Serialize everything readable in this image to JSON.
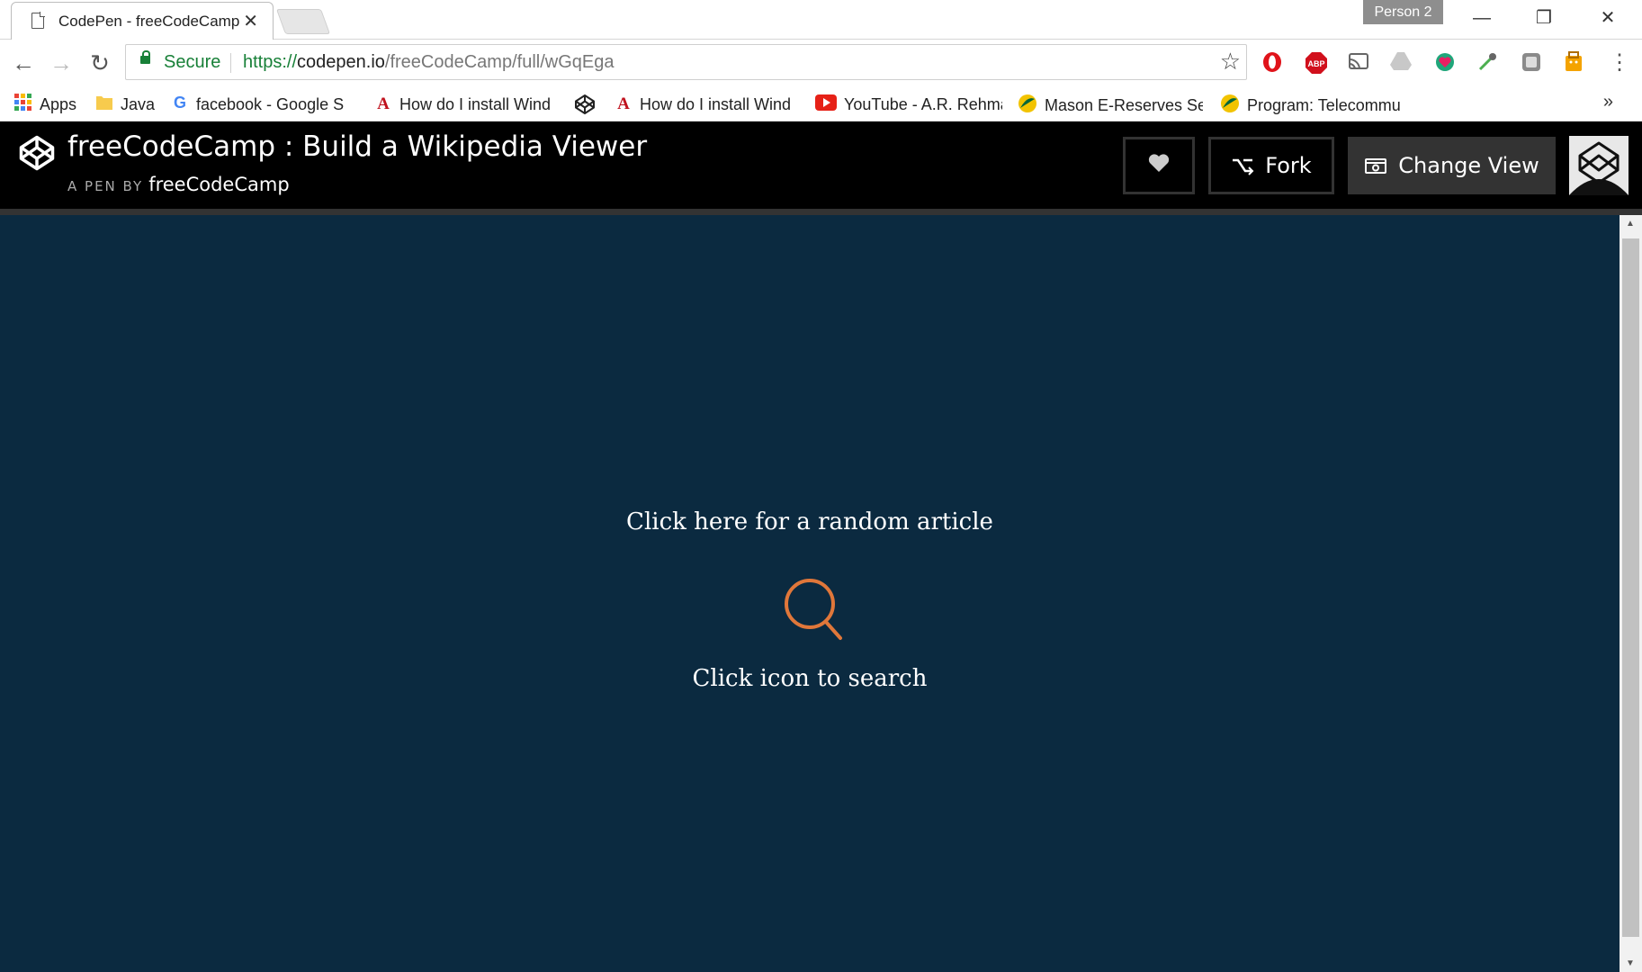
{
  "browser": {
    "tab_title": "CodePen - freeCodeCamp",
    "person": "Person 2",
    "secure_label": "Secure",
    "url_scheme": "https://",
    "url_host": "codepen.io",
    "url_path": "/freeCodeCamp/full/wGqEga"
  },
  "bookmarks": [
    {
      "label": "Apps"
    },
    {
      "label": "Java"
    },
    {
      "label": "facebook - Google S"
    },
    {
      "label": "How do I install Wind"
    },
    {
      "label": "How do I install Wind"
    },
    {
      "label": "YouTube - A.R. Rehma"
    },
    {
      "label": "Mason E-Reserves Sea"
    },
    {
      "label": "Program: Telecommu"
    }
  ],
  "codepen": {
    "title": "freeCodeCamp : Build a Wikipedia Viewer",
    "by_label": "A PEN BY",
    "author": "freeCodeCamp",
    "fork_label": "Fork",
    "change_view_label": "Change View"
  },
  "pen": {
    "random_article": "Click here for a random article",
    "search_hint": "Click icon to search"
  },
  "colors": {
    "pen_bg": "#0b2a40",
    "search_icon": "#e0773a",
    "secure_green": "#188038"
  }
}
